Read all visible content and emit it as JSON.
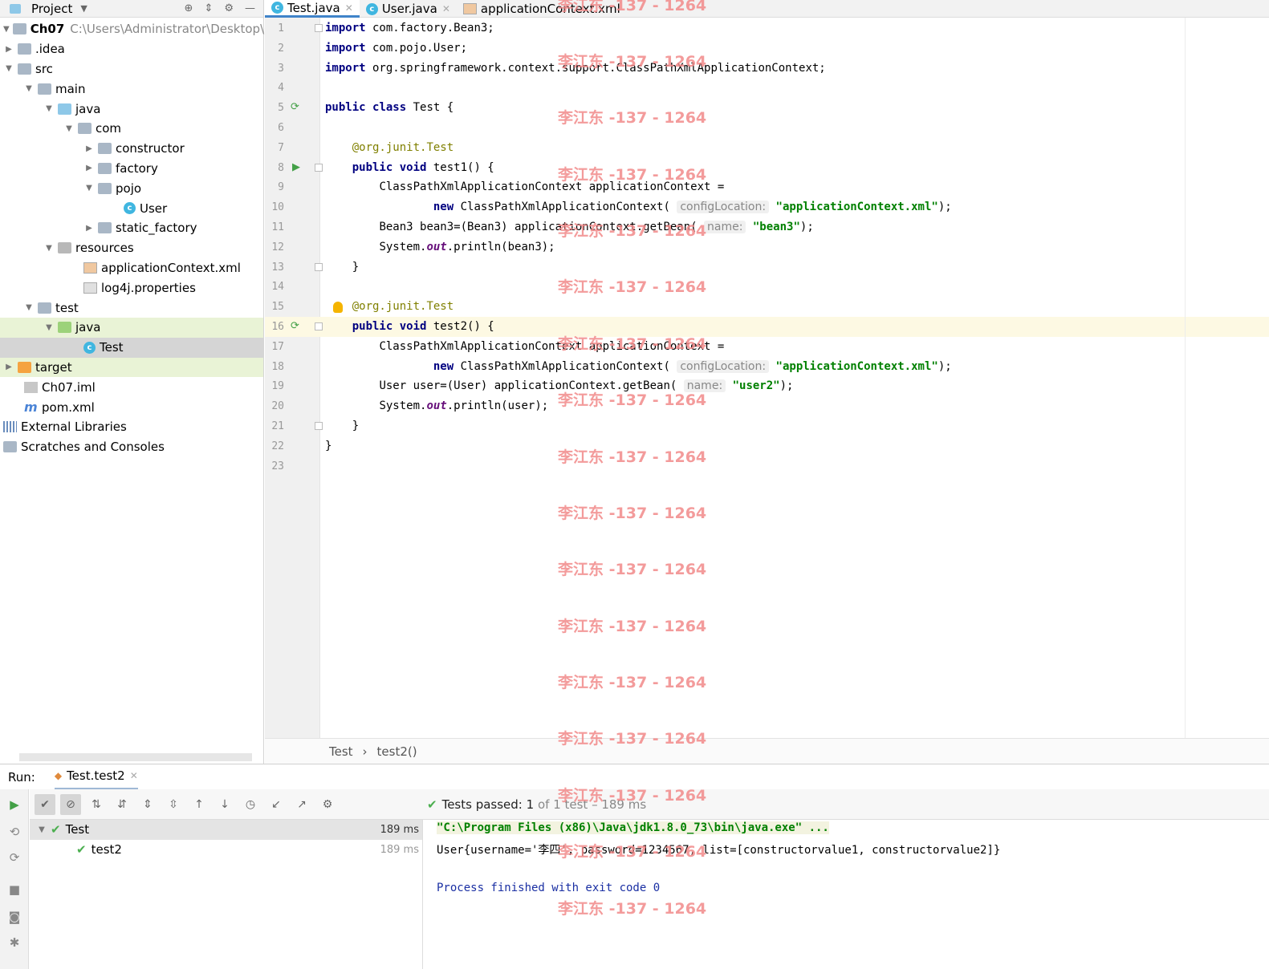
{
  "watermark": "李江东 -137 - 1264",
  "sidebar": {
    "title": "Project",
    "tree": [
      {
        "label": "Ch07",
        "extra": "C:\\Users\\Administrator\\Desktop\\Ch"
      },
      {
        "label": ".idea"
      },
      {
        "label": "src"
      },
      {
        "label": "main"
      },
      {
        "label": "java"
      },
      {
        "label": "com"
      },
      {
        "label": "constructor"
      },
      {
        "label": "factory"
      },
      {
        "label": "pojo"
      },
      {
        "label": "User"
      },
      {
        "label": "static_factory"
      },
      {
        "label": "resources"
      },
      {
        "label": "applicationContext.xml"
      },
      {
        "label": "log4j.properties"
      },
      {
        "label": "test"
      },
      {
        "label": "java"
      },
      {
        "label": "Test"
      },
      {
        "label": "target"
      },
      {
        "label": "Ch07.iml"
      },
      {
        "label": "pom.xml"
      },
      {
        "label": "External Libraries"
      },
      {
        "label": "Scratches and Consoles"
      }
    ]
  },
  "tabs": [
    {
      "label": "Test.java"
    },
    {
      "label": "User.java"
    },
    {
      "label": "applicationContext.xml"
    }
  ],
  "editor": {
    "line_numbers": [
      "1",
      "2",
      "3",
      "4",
      "5",
      "6",
      "7",
      "8",
      "9",
      "10",
      "11",
      "12",
      "13",
      "14",
      "15",
      "16",
      "17",
      "18",
      "19",
      "20",
      "21",
      "22",
      "23"
    ],
    "kw": {
      "import": "import",
      "public": "public",
      "class": "class",
      "void": "void",
      "new": "new"
    },
    "l1": " com.factory.Bean3;",
    "l2": " com.pojo.User;",
    "l3": " org.springframework.context.support.ClassPathXmlApplicationContext;",
    "l5": " Test {",
    "ann_prefix": "@org.junit.",
    "ann_name": "Test",
    "l8": " test1() {",
    "l9": "ClassPathXmlApplicationContext applicationContext =",
    "l10a": " ClassPathXmlApplicationContext( ",
    "hint_config": "configLocation:",
    "str_ctx": "\"applicationContext.xml\"",
    "close": ");",
    "l11a": "Bean3 bean3=(Bean3) applicationContext.getBean( ",
    "hint_name": "name:",
    "str_bean3": "\"bean3\"",
    "sys": "System.",
    "out": "out",
    "l12b": ".println(bean3);",
    "brace_close": "}",
    "l16": " test2() {",
    "l19a": "User user=(User) applicationContext.getBean( ",
    "str_user2": "\"user2\"",
    "l20b": ".println(user);"
  },
  "breadcrumb": {
    "class": "Test",
    "method": "test2()",
    "sep": "›"
  },
  "run": {
    "label": "Run:",
    "tab": "Test.test2",
    "status_prefix": "Tests passed:",
    "status_count": "1",
    "status_rest": "of 1 test – 189 ms",
    "tests": [
      {
        "name": "Test",
        "ms": "189 ms"
      },
      {
        "name": "test2",
        "ms": "189 ms"
      }
    ],
    "console": [
      "\"C:\\Program Files (x86)\\Java\\jdk1.8.0_73\\bin\\java.exe\" ...",
      "User{username='李四', password=1234567, list=[constructorvalue1, constructorvalue2]}",
      "Process finished with exit code 0"
    ]
  }
}
